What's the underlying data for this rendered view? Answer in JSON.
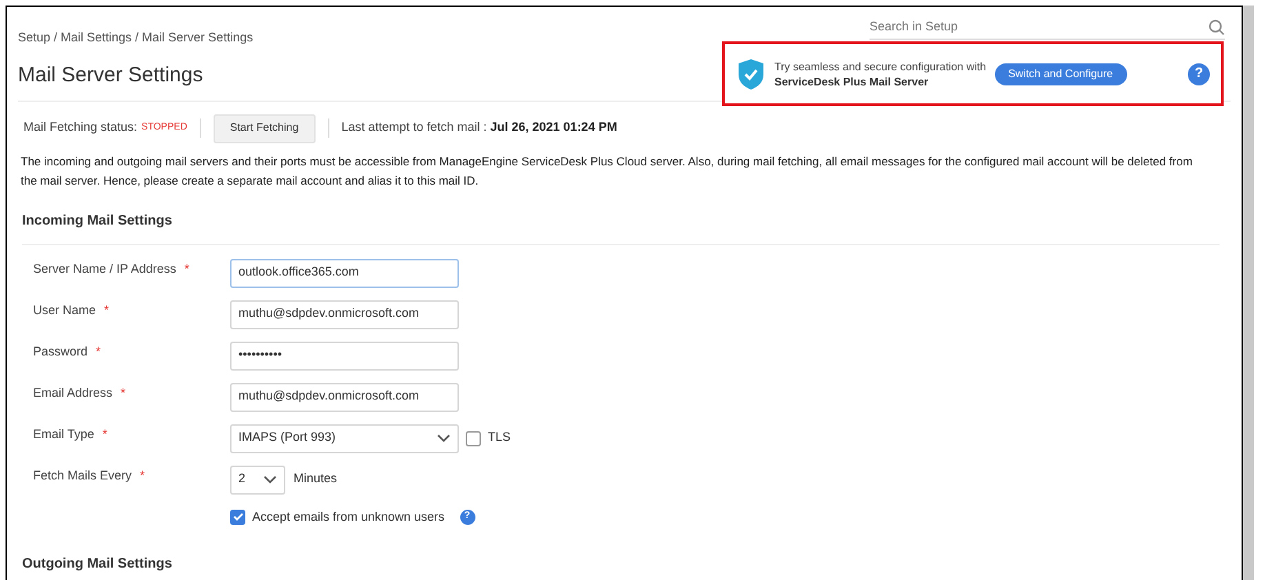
{
  "breadcrumb": "Setup / Mail Settings / Mail Server Settings",
  "title": "Mail Server Settings",
  "search": {
    "placeholder": "Search in Setup"
  },
  "promo": {
    "text": "Try seamless and secure configuration with",
    "bold_text": "ServiceDesk Plus Mail Server",
    "button": "Switch and Configure",
    "help": "?"
  },
  "fetch_bar": {
    "label": "Mail Fetching status:",
    "status": "STOPPED",
    "button": "Start Fetching",
    "last_attempt_label": "Last attempt to fetch mail :",
    "last_attempt_value": "Jul 26, 2021 01:24 PM"
  },
  "notice": "The incoming and outgoing mail servers and their ports must be accessible from ManageEngine ServiceDesk Plus Cloud server. Also, during mail fetching, all email messages for the configured mail account will be deleted from the mail server. Hence, please create a separate mail account and alias it to this mail ID.",
  "incoming": {
    "heading": "Incoming Mail Settings",
    "fields": [
      {
        "label": "Server Name / IP Address",
        "required_mark": "*",
        "kind": "text",
        "value": "outlook.office365.com",
        "focused": true
      },
      {
        "label": "User Name",
        "required_mark": "*",
        "kind": "text",
        "value": "muthu@sdpdev.onmicrosoft.com",
        "focused": false
      },
      {
        "label": "Password",
        "required_mark": "*",
        "kind": "text",
        "value": "••••••••••",
        "focused": false
      },
      {
        "label": "Email Address",
        "required_mark": "*",
        "kind": "text",
        "value": "muthu@sdpdev.onmicrosoft.com",
        "focused": false
      },
      {
        "label": "Email Type",
        "required_mark": "*",
        "kind": "select",
        "value": "IMAPS (Port 993)",
        "option_label": "TLS",
        "option_checked": false
      },
      {
        "label": "Fetch Mails Every",
        "required_mark": "*",
        "kind": "short-select",
        "value": "2",
        "suffix": "Minutes"
      }
    ],
    "accept": {
      "label": "Accept emails from unknown users",
      "checked": true,
      "help": "?"
    }
  },
  "outgoing": {
    "heading": "Outgoing Mail Settings"
  }
}
